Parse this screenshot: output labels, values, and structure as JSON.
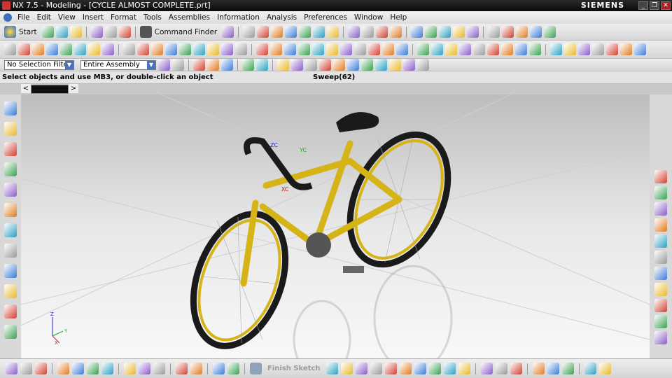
{
  "window": {
    "title": "NX 7.5 - Modeling - [CYCLE ALMOST COMPLETE.prt]",
    "brand": "SIEMENS",
    "controls": [
      "_",
      "❐",
      "✕"
    ]
  },
  "menu": [
    "File",
    "Edit",
    "View",
    "Insert",
    "Format",
    "Tools",
    "Assemblies",
    "Information",
    "Analysis",
    "Preferences",
    "Window",
    "Help"
  ],
  "toolbar1": {
    "start_label": "Start",
    "command_finder_label": "Command Finder"
  },
  "toolbar3": {
    "selection_filter": "No Selection Filter",
    "assembly_scope": "Entire Assembly"
  },
  "status": {
    "prompt": "Select objects and use MB3, or double-click an object",
    "feature": "Sweep(62)"
  },
  "tabs": {
    "left_arrow": "<",
    "right_arrow": ">"
  },
  "bottom": {
    "finish_sketch_label": "Finish Sketch"
  },
  "viewport": {
    "triad_labels": [
      "XC",
      "YC",
      "ZC"
    ],
    "corner_axes": [
      "X",
      "Y",
      "Z"
    ],
    "bike_color": "#d6b418"
  }
}
